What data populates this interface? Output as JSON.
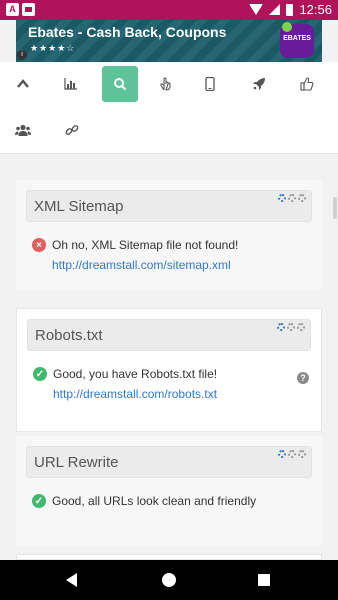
{
  "status_bar": {
    "time": "12:56",
    "notification_icons": [
      "message-icon",
      "a-icon"
    ],
    "a_icon_text": "A",
    "system_icons": [
      "wifi-icon",
      "signal-icon",
      "battery-icon"
    ]
  },
  "ad": {
    "title": "Ebates - Cash Back, Coupons",
    "rating_stars": "★★★★☆",
    "logo_text": "EBATES",
    "info_text": "i"
  },
  "toolbar": {
    "icons": [
      "chevron-up-icon",
      "bar-chart-icon",
      "search-icon",
      "pointer-hand-icon",
      "mobile-phone-icon",
      "rocket-icon",
      "thumbs-up-icon",
      "users-icon",
      "link-icon"
    ],
    "active_icon": "search-icon",
    "colors": {
      "active": "#5fc39a",
      "icon": "#555555"
    }
  },
  "sections": [
    {
      "title": "XML Sitemap",
      "status": "error",
      "message": "Oh no, XML Sitemap file not found!",
      "link": "http://dreamstall.com/sitemap.xml"
    },
    {
      "title": "Robots.txt",
      "status": "ok",
      "message": "Good, you have Robots.txt file!",
      "link": "http://dreamstall.com/robots.txt",
      "help_icon": "question-icon"
    },
    {
      "title": "URL Rewrite",
      "status": "ok",
      "message": "Good, all URLs look clean and friendly"
    }
  ],
  "icons": {
    "error": "×",
    "ok": "✓",
    "help": "?"
  },
  "colors": {
    "status_bar": "#b0135a",
    "link": "#2f79c9",
    "error": "#e35d5d",
    "ok": "#3fb96f",
    "gear_blue": "#3a78c5"
  },
  "nav_bar": {
    "buttons": [
      "back-icon",
      "home-icon",
      "recent-apps-icon"
    ]
  }
}
